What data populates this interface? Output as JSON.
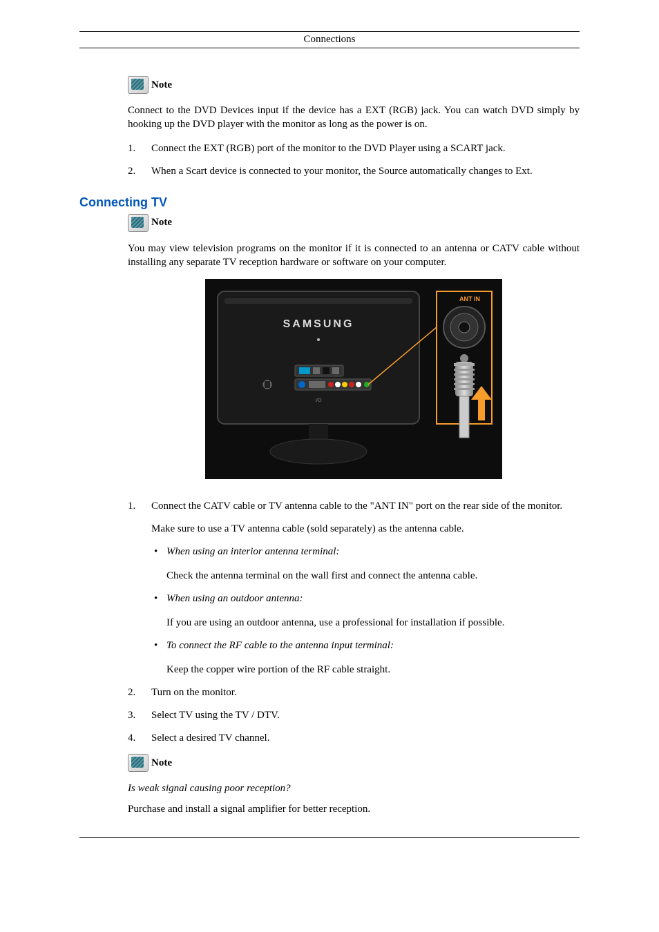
{
  "header": {
    "title": "Connections"
  },
  "note_label": " Note",
  "intro_para": "Connect to the DVD Devices input if the device has a EXT (RGB) jack. You can watch DVD simply by hooking up the DVD player with the monitor as long as the power is on.",
  "dvd_steps": [
    "Connect the EXT (RGB) port of the monitor to the DVD Player using a SCART jack.",
    "When a Scart device is connected to your monitor, the Source automatically changes to Ext."
  ],
  "section_tv": {
    "title": "Connecting TV",
    "intro": "You may view television programs on the monitor if it is connected to an antenna or CATV cable without installing any separate TV reception hardware or software on your computer.",
    "figure": {
      "brand": "SAMSUNG",
      "port_label": "ANT IN"
    },
    "step1": "Connect the CATV cable or TV antenna cable to the \"ANT IN\" port on the rear side of the monitor.",
    "step1_sub": "Make sure to use a TV antenna cable (sold separately) as the antenna cable.",
    "bullets": [
      {
        "title": "When using an interior antenna terminal:",
        "desc": "Check the antenna terminal on the wall first and connect the antenna cable."
      },
      {
        "title": "When using an outdoor antenna:",
        "desc": "If you are using an outdoor antenna, use a professional for installation if possible."
      },
      {
        "title": "To connect the RF cable to the antenna input terminal:",
        "desc": "Keep the copper wire portion of the RF cable straight."
      }
    ],
    "step2": "Turn on the monitor.",
    "step3": "Select TV using the TV / DTV.",
    "step4": "Select a desired TV channel.",
    "end_note_q": "Is weak signal causing poor reception?",
    "end_note_a": "Purchase and install a signal amplifier for better reception."
  }
}
